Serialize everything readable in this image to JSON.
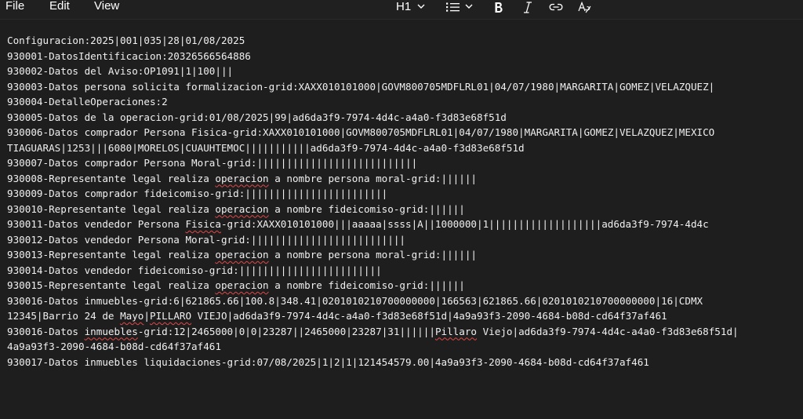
{
  "menu": {
    "file": "File",
    "edit": "Edit",
    "view": "View"
  },
  "toolbar": {
    "heading": "H1",
    "icons": [
      "chevron-down-icon",
      "list-icon",
      "bold-icon",
      "italic-icon",
      "link-icon",
      "clear-formatting-icon"
    ]
  },
  "colors": {
    "background": "#1e1e1e",
    "topbar": "#202020",
    "text": "#f0f0f0",
    "spellcheck": "#e04848"
  },
  "document": {
    "lines": [
      [
        {
          "t": "Configuracion:2025|001|035|28|01/08/2025"
        }
      ],
      [
        {
          "t": "930001-DatosIdentificacion:20326566564886"
        }
      ],
      [
        {
          "t": "930002-Datos del Aviso:OP1091|1|100|||"
        }
      ],
      [
        {
          "t": "930003-Datos persona solicita formalizacion-grid:XAXX010101000|GOVM800705MDFLRL01|04/07/1980|MARGARITA|GOMEZ|VELAZQUEZ|"
        }
      ],
      [
        {
          "t": "930004-DetalleOperaciones:2"
        }
      ],
      [
        {
          "t": "930005-Datos de la operacion-grid:01/08/2025|99|ad6da3f9-7974-4d4c-a4a0-f3d83e68f51d"
        }
      ],
      [
        {
          "t": "930006-Datos comprador Persona Fisica-grid:XAXX010101000|GOVM800705MDFLRL01|04/07/1980|MARGARITA|GOMEZ|VELAZQUEZ|MEXICO"
        }
      ],
      [
        {
          "t": "TIAGUARAS|1253|||6080|MORELOS|CUAUHTEMOC|||||||||||ad6da3f9-7974-4d4c-a4a0-f3d83e68f51d"
        }
      ],
      [
        {
          "t": "930007-Datos comprador Persona Moral-grid:|||||||||||||||||||||||||||"
        }
      ],
      [
        {
          "t": "930008-Representante legal realiza "
        },
        {
          "t": "operacion",
          "s": 1
        },
        {
          "t": " a nombre persona moral-grid:||||||"
        }
      ],
      [
        {
          "t": "930009-Datos comprador fideicomiso-grid:||||||||||||||||||||||||"
        }
      ],
      [
        {
          "t": "930010-Representante legal realiza "
        },
        {
          "t": "operacion",
          "s": 1
        },
        {
          "t": " a nombre fideicomiso-grid:||||||"
        }
      ],
      [
        {
          "t": "930011-Datos vendedor Persona "
        },
        {
          "t": "Fisica",
          "s": 1
        },
        {
          "t": "-grid:XAXX010101000|||aaaaa|ssss|A||1000000|1|||||||||||||||||||ad6da3f9-7974-4d4c"
        }
      ],
      [
        {
          "t": "930012-Datos vendedor Persona Moral-grid:||||||||||||||||||||||||||"
        }
      ],
      [
        {
          "t": "930013-Representante legal realiza "
        },
        {
          "t": "operacion",
          "s": 1
        },
        {
          "t": " a nombre persona moral-grid:||||||"
        }
      ],
      [
        {
          "t": "930014-Datos vendedor fideicomiso-grid:||||||||||||||||||||||||"
        }
      ],
      [
        {
          "t": "930015-Representante legal realiza "
        },
        {
          "t": "operacion",
          "s": 1
        },
        {
          "t": " a nombre fideicomiso-grid:||||||"
        }
      ],
      [
        {
          "t": "930016-Datos inmuebles-grid:6|621865.66|100.8|348.41|0201010210700000000|166563|621865.66|0201010210700000000|16|CDMX"
        }
      ],
      [
        {
          "t": "12345|Barrio 24 de "
        },
        {
          "t": "Mayo",
          "s": 1
        },
        {
          "t": "|"
        },
        {
          "t": "PILLARO",
          "s": 1
        },
        {
          "t": " VIEJO|ad6da3f9-7974-4d4c-a4a0-f3d83e68f51d|4a9a93f3-2090-4684-b08d-cd64f37af461"
        }
      ],
      [
        {
          "t": "930016-Datos "
        },
        {
          "t": "inmuebles",
          "s": 1
        },
        {
          "t": "-grid:12|2465000|0|0|23287||2465000|23287|31||||||"
        },
        {
          "t": "Pillaro",
          "s": 1
        },
        {
          "t": " Viejo|ad6da3f9-7974-4d4c-a4a0-f3d83e68f51d|"
        }
      ],
      [
        {
          "t": "4a9a93f3-2090-4684-b08d-cd64f37af461"
        }
      ],
      [
        {
          "t": "930017-Datos inmuebles liquidaciones-grid:07/08/2025|1|2|1|121454579.00|4a9a93f3-2090-4684-b08d-cd64f37af461"
        }
      ]
    ]
  }
}
